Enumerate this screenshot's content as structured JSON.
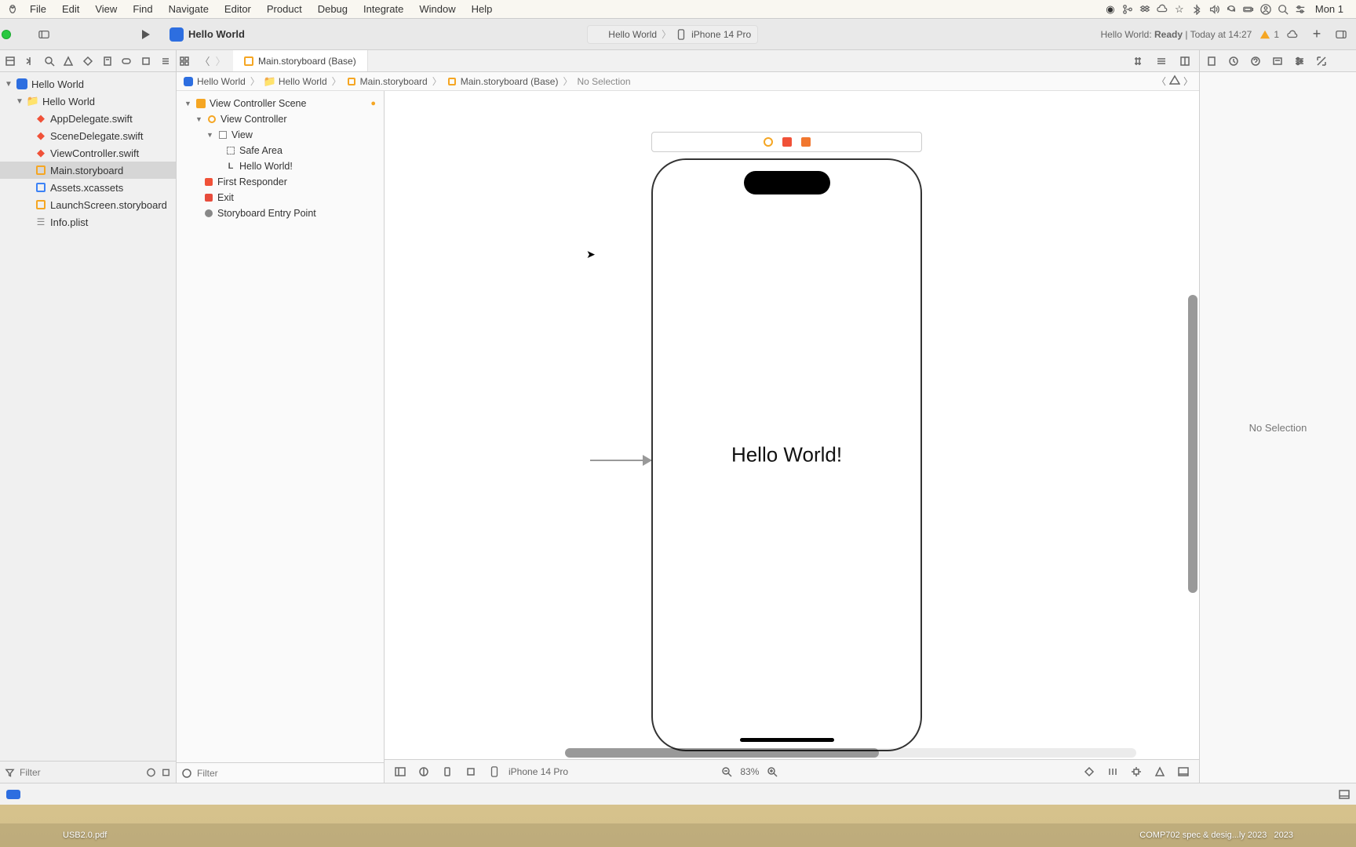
{
  "menubar": {
    "app": "",
    "items": [
      "File",
      "Edit",
      "View",
      "Find",
      "Navigate",
      "Editor",
      "Product",
      "Debug",
      "Integrate",
      "Window",
      "Help"
    ],
    "clock": "Mon 1"
  },
  "titlebar": {
    "project_name": "Hello World",
    "scheme_app": "Hello World",
    "scheme_device": "iPhone 14 Pro",
    "status_prefix": "Hello World: ",
    "status_state": "Ready",
    "status_time": " | Today at 14:27",
    "warning_count": "1"
  },
  "tabs": {
    "open_tab": "Main.storyboard (Base)"
  },
  "navigator": {
    "root": "Hello World",
    "group": "Hello World",
    "files": [
      {
        "name": "AppDelegate.swift",
        "icon": "swift"
      },
      {
        "name": "SceneDelegate.swift",
        "icon": "swift"
      },
      {
        "name": "ViewController.swift",
        "icon": "swift"
      },
      {
        "name": "Main.storyboard",
        "icon": "sb",
        "sel": true
      },
      {
        "name": "Assets.xcassets",
        "icon": "assets"
      },
      {
        "name": "LaunchScreen.storyboard",
        "icon": "sb"
      },
      {
        "name": "Info.plist",
        "icon": "plist"
      }
    ],
    "filter_placeholder": "Filter"
  },
  "crumbs": {
    "c0": "Hello World",
    "c1": "Hello World",
    "c2": "Main.storyboard",
    "c3": "Main.storyboard (Base)",
    "c4": "No Selection"
  },
  "outline": {
    "scene": "View Controller Scene",
    "vc": "View Controller",
    "view": "View",
    "safe": "Safe Area",
    "label": "Hello World!",
    "fr": "First Responder",
    "exit": "Exit",
    "entry": "Storyboard Entry Point",
    "filter_placeholder": "Filter"
  },
  "canvas": {
    "hello_text": "Hello World!",
    "device_name": "iPhone 14 Pro",
    "zoom": "83%"
  },
  "inspector": {
    "placeholder": "No Selection"
  },
  "dock": {
    "left_label": "USB2.0.pdf",
    "right_label1": "COMP702 spec & desig...ly 2023",
    "right_label2": "2023"
  }
}
